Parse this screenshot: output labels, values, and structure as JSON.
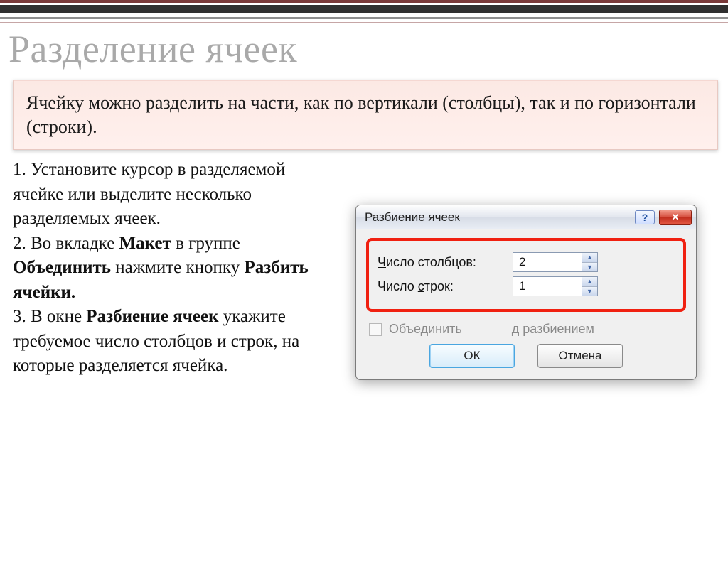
{
  "title": "Разделение ячеек",
  "intro": "Ячейку можно разделить на части, как по вертикали (столбцы), так и по горизонтали (строки).",
  "steps": {
    "s1": {
      "prefix": "1. Установите курсор в разделяемой ячейке или выделите несколько разделяемых ячеек."
    },
    "s2": {
      "a": "2. Во вкладке ",
      "b": "Макет",
      "c": " в группе ",
      "d": "Объединить",
      "e": " нажмите кнопку ",
      "f": "Разбить ячейки."
    },
    "s3": {
      "a": "3. В окне ",
      "b": "Разбиение ячеек",
      "c": "  укажите требуемое число столбцов и строк, на которые разделяется ячейка."
    }
  },
  "dialog": {
    "title": "Разбиение ячеек",
    "cols_label_u": "Ч",
    "cols_label_rest": "исло столбцов:",
    "cols_value": "2",
    "rows_label_a": "Число ",
    "rows_label_u": "с",
    "rows_label_b": "трок:",
    "rows_value": "1",
    "merge_a": "Объединить",
    "merge_b": "д разбиением",
    "ok": "ОК",
    "cancel": "Отмена"
  }
}
